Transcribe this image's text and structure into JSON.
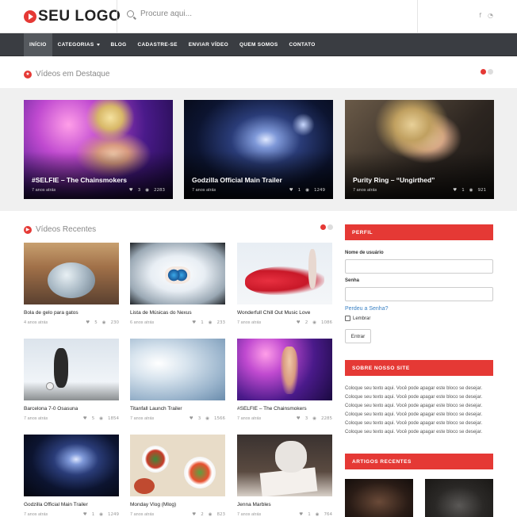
{
  "header": {
    "logo_text": "SEU LOGO",
    "search_placeholder": "Procure aqui...",
    "social": [
      "f",
      "rss"
    ]
  },
  "nav": {
    "items": [
      {
        "label": "INÍCIO",
        "active": true
      },
      {
        "label": "CATEGORIAS",
        "dropdown": true
      },
      {
        "label": "BLOG"
      },
      {
        "label": "CADASTRE-SE"
      },
      {
        "label": "ENVIAR VÍDEO"
      },
      {
        "label": "QUEM SOMOS"
      },
      {
        "label": "CONTATO"
      }
    ]
  },
  "featured": {
    "title": "Vídeos em Destaque",
    "items": [
      {
        "title": "#SELFIE – The Chainsmokers",
        "age": "7 anos atrás",
        "likes": "3",
        "views": "2283"
      },
      {
        "title": "Godzilla Official Main Trailer",
        "age": "7 anos atrás",
        "likes": "1",
        "views": "1249"
      },
      {
        "title": "Purity Ring – “Ungirthed”",
        "age": "7 anos atrás",
        "likes": "1",
        "views": "921"
      }
    ]
  },
  "recent": {
    "title": "Vídeos Recentes",
    "items": [
      {
        "title": "Bola de gelo para gatos",
        "age": "4 anos atrás",
        "likes": "5",
        "views": "230"
      },
      {
        "title": "Lista de Músicas do Nexus",
        "age": "6 anos atrás",
        "likes": "1",
        "views": "233"
      },
      {
        "title": "Wonderfull Chill Out Music Love",
        "age": "7 anos atrás",
        "likes": "2",
        "views": "1086"
      },
      {
        "title": "Barcelona 7-0 Osasuna",
        "age": "7 anos atrás",
        "likes": "5",
        "views": "1854"
      },
      {
        "title": "Titanfall Launch Trailer",
        "age": "7 anos atrás",
        "likes": "3",
        "views": "1566"
      },
      {
        "title": "#SELFIE – The Chainsmokers",
        "age": "7 anos atrás",
        "likes": "3",
        "views": "2285"
      },
      {
        "title": "Godzilla Official Main Trailer",
        "age": "7 anos atrás",
        "likes": "1",
        "views": "1249"
      },
      {
        "title": "Monday Vlog (Mlog)",
        "age": "7 anos atrás",
        "likes": "2",
        "views": "823"
      },
      {
        "title": "Jenna Marbles",
        "age": "7 anos atrás",
        "likes": "1",
        "views": "764"
      }
    ]
  },
  "sidebar": {
    "profile_title": "PERFIL",
    "username_label": "Nome de usuário",
    "password_label": "Senha",
    "forgot_link": "Perdeu a Senha?",
    "remember_label": "Lembrar",
    "login_button": "Entrar",
    "about_title": "SOBRE NOSSO SITE",
    "about_lines": [
      "Coloque seu texto aqui. Você pode apagar este bloco se desejar.",
      "Coloque seu texto aqui. Você pode apagar este bloco se desejar.",
      "Coloque seu texto aqui. Você pode apagar este bloco se desejar.",
      "Coloque seu texto aqui. Você pode apagar este bloco se desejar.",
      "Coloque seu texto aqui. Você pode apagar este bloco se desejar.",
      "Coloque seu texto aqui. Você pode apagar este bloco se desejar."
    ],
    "articles_title": "ARTIGOS RECENTES"
  },
  "colors": {
    "accent": "#e53935",
    "nav_bg": "#3a3d42",
    "link": "#3b82c4"
  }
}
